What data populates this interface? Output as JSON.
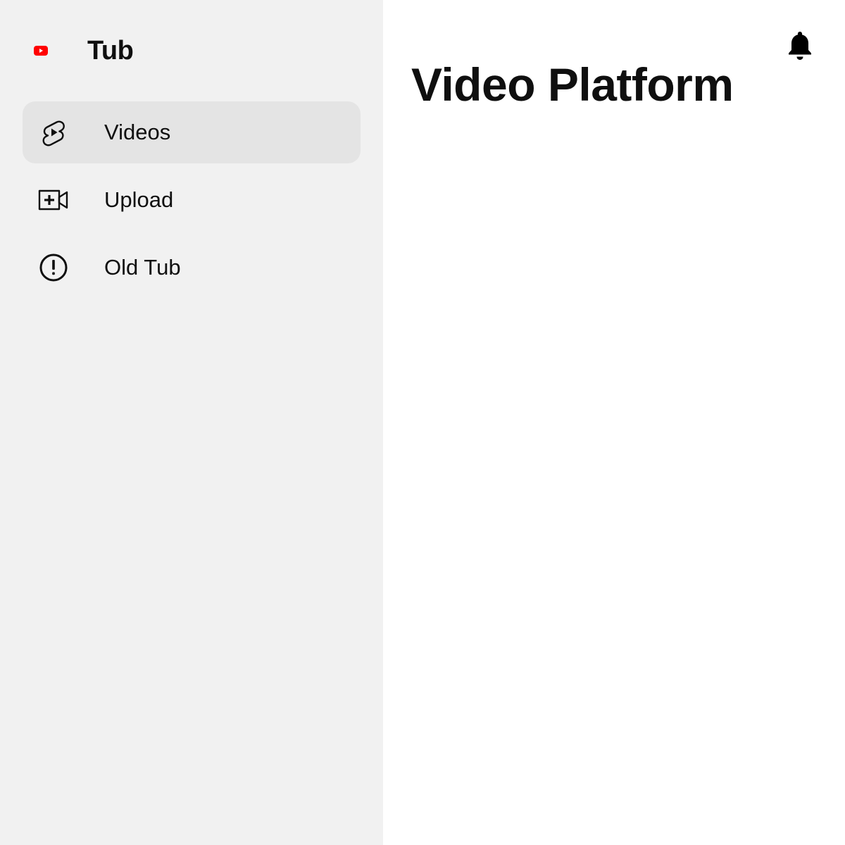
{
  "brand": {
    "name": "Tub",
    "logo_icon": "play-logo-icon",
    "logo_color": "#ff0000"
  },
  "sidebar": {
    "items": [
      {
        "label": "Videos",
        "icon": "shorts-icon",
        "active": true
      },
      {
        "label": "Upload",
        "icon": "video-add-icon",
        "active": false
      },
      {
        "label": "Old Tub",
        "icon": "alert-circle-icon",
        "active": false
      }
    ]
  },
  "main": {
    "title": "Video Platform",
    "notification_icon": "bell-icon"
  },
  "colors": {
    "sidebar_bg": "#f1f1f1",
    "active_item_bg": "#e4e4e4",
    "text": "#0f0f0f",
    "brand_red": "#ff0000"
  }
}
